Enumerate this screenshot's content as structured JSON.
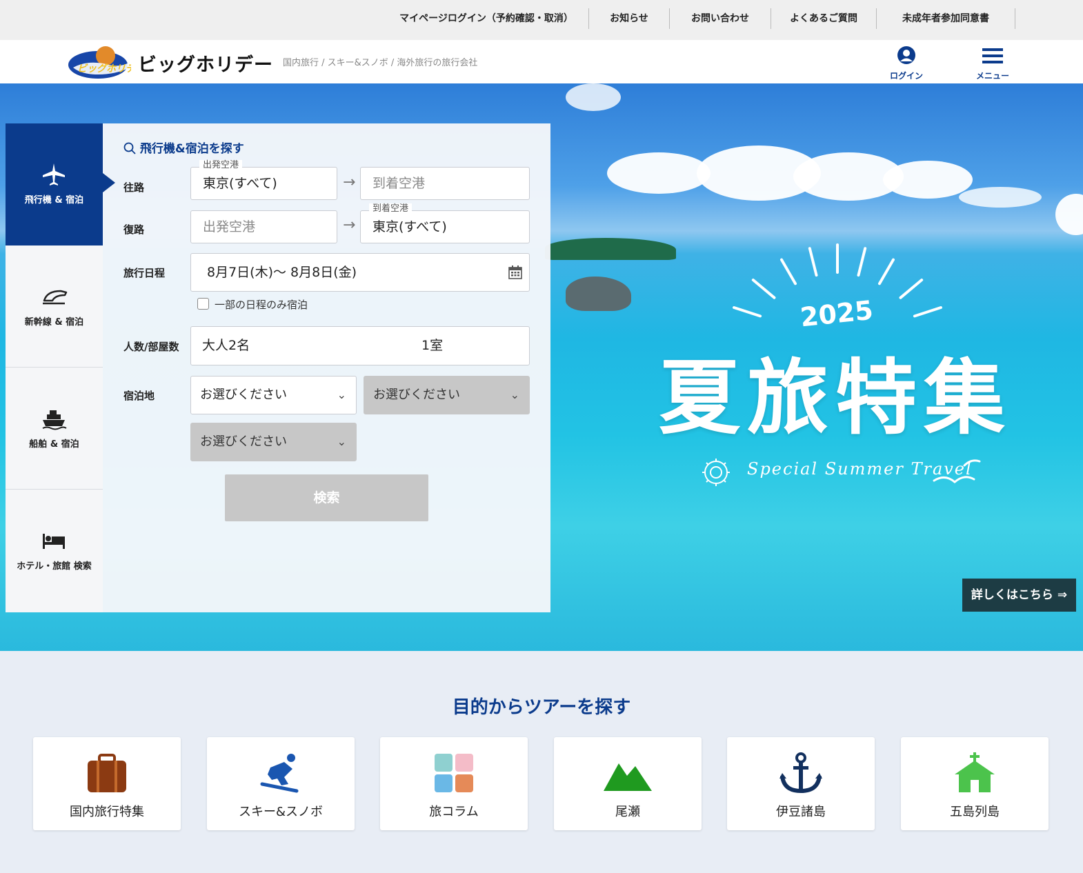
{
  "utility_nav": [
    {
      "label": "マイページログイン（予約確認・取消）"
    },
    {
      "label": "お知らせ"
    },
    {
      "label": "お問い合わせ"
    },
    {
      "label": "よくあるご質問"
    },
    {
      "label": "未成年者参加同意書"
    }
  ],
  "header": {
    "logo_text": "ビッグホリデー",
    "tagline": "国内旅行 / スキー&スノボ / 海外旅行の旅行会社",
    "login_label": "ログイン",
    "menu_label": "メニュー"
  },
  "hero": {
    "year": "2025",
    "title": "夏旅特集",
    "subtitle": "Special Summer Travel",
    "details_button": "詳しくはこちら ⇒"
  },
  "search": {
    "tabs": [
      {
        "label": "飛行機 & 宿泊",
        "icon": "airplane-icon",
        "active": true
      },
      {
        "label": "新幹線 & 宿泊",
        "icon": "shinkansen-icon",
        "active": false
      },
      {
        "label": "船舶 & 宿泊",
        "icon": "ship-icon",
        "active": false
      },
      {
        "label": "ホテル・旅館 検索",
        "icon": "bed-icon",
        "active": false
      }
    ],
    "title": "飛行機&宿泊を探す",
    "outbound": {
      "label": "往路",
      "departure_legend": "出発空港",
      "departure_value": "東京(すべて)",
      "arrival_placeholder": "到着空港"
    },
    "return": {
      "label": "復路",
      "departure_placeholder": "出発空港",
      "arrival_legend": "到着空港",
      "arrival_value": "東京(すべて)"
    },
    "schedule": {
      "label": "旅行日程",
      "value": "8月7日(木)～  8月8日(金)",
      "partial_stay_label": "一部の日程のみ宿泊"
    },
    "guests": {
      "label": "人数/部屋数",
      "people": "大人2名",
      "rooms": "1室"
    },
    "stay_area": {
      "label": "宿泊地",
      "select1": "お選びください",
      "select2": "お選びください",
      "select3": "お選びください"
    },
    "submit_label": "検索"
  },
  "purpose": {
    "title": "目的からツアーを探す",
    "cards": [
      {
        "label": "国内旅行特集",
        "icon": "suitcase-icon"
      },
      {
        "label": "スキー&スノボ",
        "icon": "snowboarder-icon"
      },
      {
        "label": "旅コラム",
        "icon": "grid-icon"
      },
      {
        "label": "尾瀬",
        "icon": "mountain-icon"
      },
      {
        "label": "伊豆諸島",
        "icon": "anchor-icon"
      },
      {
        "label": "五島列島",
        "icon": "church-icon"
      }
    ]
  },
  "colors": {
    "brand_navy": "#0b3b8c",
    "disabled_gray": "#c7c7c7",
    "details_button_bg": "#1d3c44"
  }
}
